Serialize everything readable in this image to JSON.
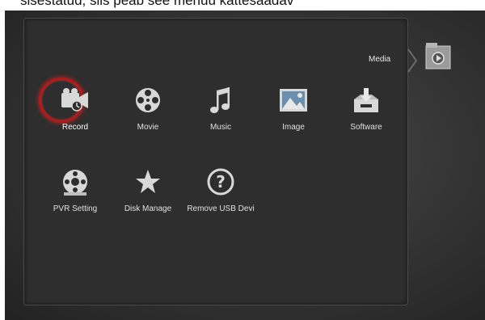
{
  "caption": "sisestatud, siis peab see menüü kättesaadav",
  "header": {
    "media_label": "Media"
  },
  "icons": {
    "media": "media-folder-icon"
  },
  "menu": [
    {
      "label": "Record",
      "icon": "record-camera-icon",
      "selected": true
    },
    {
      "label": "Movie",
      "icon": "film-reel-icon",
      "selected": false
    },
    {
      "label": "Music",
      "icon": "music-note-icon",
      "selected": false
    },
    {
      "label": "Image",
      "icon": "image-icon",
      "selected": false
    },
    {
      "label": "Software",
      "icon": "software-icon",
      "selected": false
    },
    {
      "label": "PVR Setting",
      "icon": "pvr-setting-icon",
      "selected": false
    },
    {
      "label": "Disk Manage",
      "icon": "disk-manage-star-icon",
      "selected": false
    },
    {
      "label": "Remove USB Devi",
      "icon": "remove-usb-question-icon",
      "selected": false
    }
  ],
  "colors": {
    "selection_ring": "#b31a1a",
    "background": "#2e2e2e",
    "text": "#e0e0e0"
  }
}
